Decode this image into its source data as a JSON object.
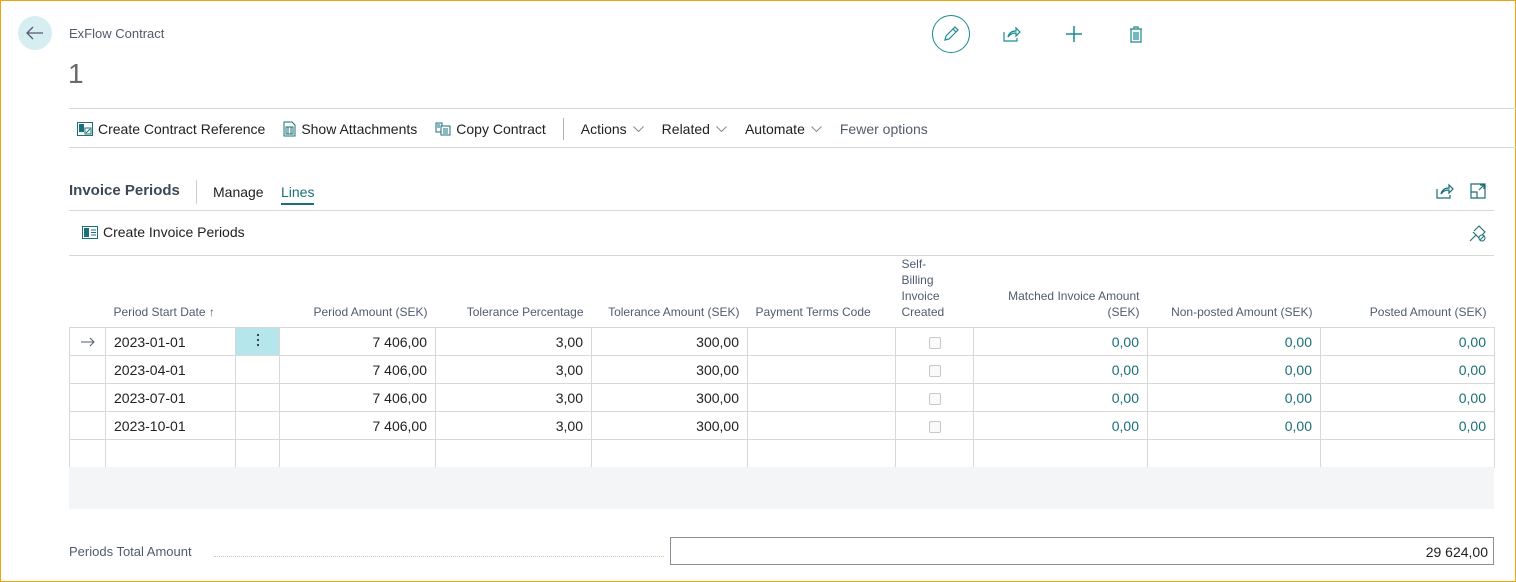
{
  "header": {
    "caption": "ExFlow Contract",
    "record_no": "1",
    "back_icon": "arrow-left-icon",
    "actions": [
      {
        "name": "edit",
        "icon": "pencil-icon"
      },
      {
        "name": "share",
        "icon": "share-icon"
      },
      {
        "name": "new",
        "icon": "plus-icon"
      },
      {
        "name": "delete",
        "icon": "trash-icon"
      }
    ]
  },
  "actionbar": {
    "items": [
      {
        "label": "Create Contract Reference",
        "icon": "contract-reference-icon"
      },
      {
        "label": "Show Attachments",
        "icon": "attachments-icon"
      },
      {
        "label": "Copy Contract",
        "icon": "copy-icon"
      }
    ],
    "menus": [
      {
        "label": "Actions"
      },
      {
        "label": "Related"
      },
      {
        "label": "Automate"
      }
    ],
    "fewer_options": "Fewer options"
  },
  "part": {
    "title": "Invoice Periods",
    "tabs": [
      {
        "label": "Manage",
        "active": false
      },
      {
        "label": "Lines",
        "active": true
      }
    ],
    "create_button": "Create Invoice Periods",
    "accent_color": "#1a6f78"
  },
  "grid": {
    "columns": [
      "Period Start Date ↑",
      "Period Amount (SEK)",
      "Tolerance Percentage",
      "Tolerance Amount (SEK)",
      "Payment Terms Code",
      "Self-\nBilling\nInvoice\nCreated",
      "Matched Invoice Amount\n(SEK)",
      "Non-posted Amount (SEK)",
      "Posted Amount (SEK)"
    ],
    "rows": [
      {
        "selected": true,
        "period_start": "2023-01-01",
        "period_amount": "7 406,00",
        "tolerance_pct": "3,00",
        "tolerance_amt": "300,00",
        "payment_terms": "",
        "self_billing": false,
        "matched": "0,00",
        "non_posted": "0,00",
        "posted": "0,00"
      },
      {
        "selected": false,
        "period_start": "2023-04-01",
        "period_amount": "7 406,00",
        "tolerance_pct": "3,00",
        "tolerance_amt": "300,00",
        "payment_terms": "",
        "self_billing": false,
        "matched": "0,00",
        "non_posted": "0,00",
        "posted": "0,00"
      },
      {
        "selected": false,
        "period_start": "2023-07-01",
        "period_amount": "7 406,00",
        "tolerance_pct": "3,00",
        "tolerance_amt": "300,00",
        "payment_terms": "",
        "self_billing": false,
        "matched": "0,00",
        "non_posted": "0,00",
        "posted": "0,00"
      },
      {
        "selected": false,
        "period_start": "2023-10-01",
        "period_amount": "7 406,00",
        "tolerance_pct": "3,00",
        "tolerance_amt": "300,00",
        "payment_terms": "",
        "self_billing": false,
        "matched": "0,00",
        "non_posted": "0,00",
        "posted": "0,00"
      }
    ],
    "row_indicator_icon": "arrow-right-icon",
    "row_menu_icon": "vertical-dots-icon"
  },
  "footer": {
    "total_label": "Periods Total Amount",
    "total_value": "29 624,00"
  }
}
